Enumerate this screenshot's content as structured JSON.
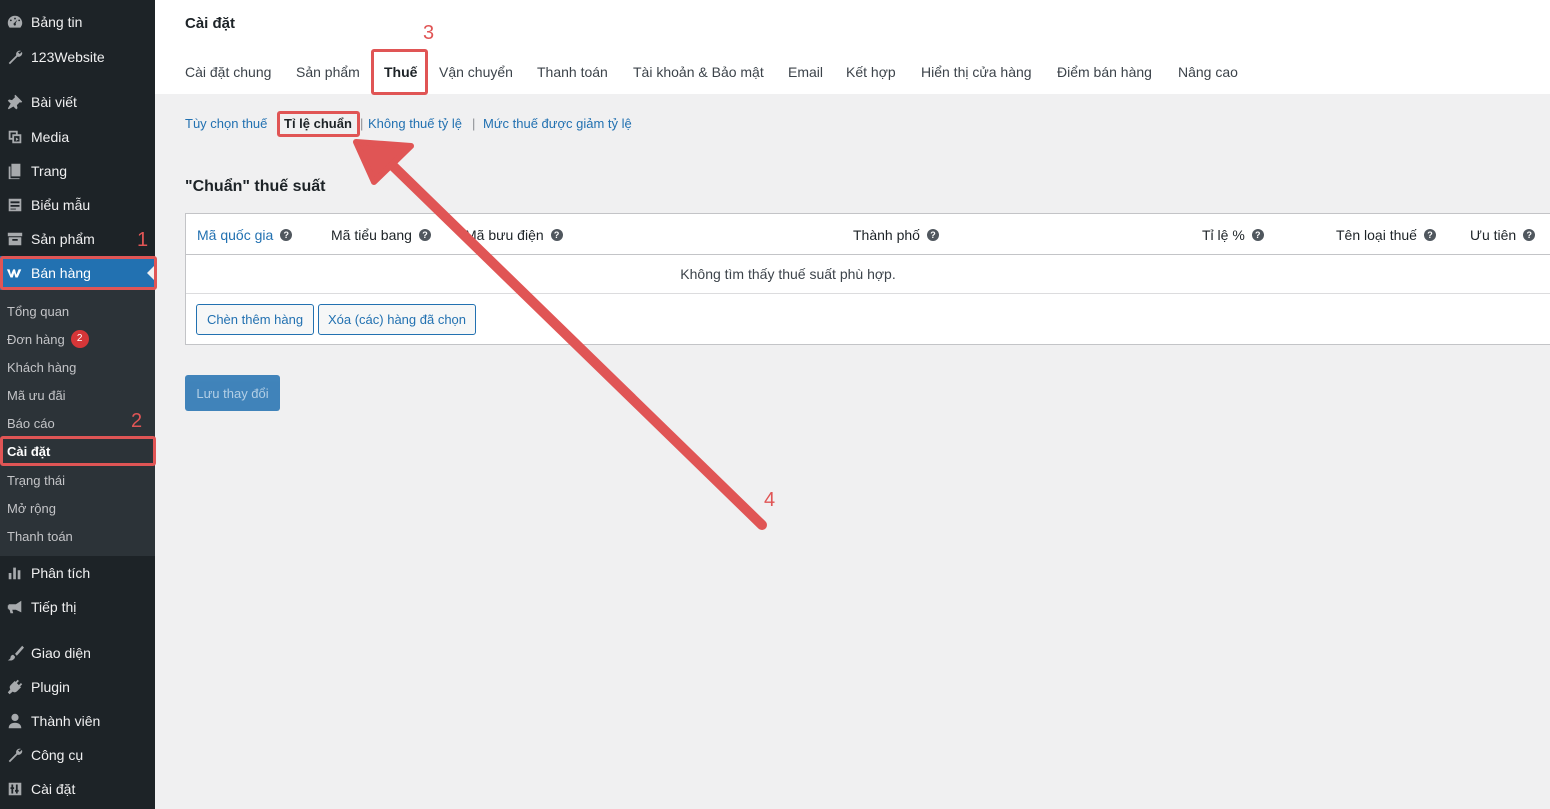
{
  "sidebar": {
    "items": [
      {
        "label": "Bảng tin",
        "icon": "dashboard-icon"
      },
      {
        "label": "123Website",
        "icon": "wrench-icon"
      },
      {
        "label": "Bài viết",
        "icon": "pin-icon"
      },
      {
        "label": "Media",
        "icon": "media-icon"
      },
      {
        "label": "Trang",
        "icon": "page-icon"
      },
      {
        "label": "Biểu mẫu",
        "icon": "form-icon"
      },
      {
        "label": "Sản phẩm",
        "icon": "archive-icon"
      },
      {
        "label": "Bán hàng",
        "icon": "woo-icon"
      },
      {
        "label": "Phân tích",
        "icon": "chart-icon"
      },
      {
        "label": "Tiếp thị",
        "icon": "megaphone-icon"
      },
      {
        "label": "Giao diện",
        "icon": "brush-icon"
      },
      {
        "label": "Plugin",
        "icon": "plug-icon"
      },
      {
        "label": "Thành viên",
        "icon": "user-icon"
      },
      {
        "label": "Công cụ",
        "icon": "tools-icon"
      },
      {
        "label": "Cài đặt",
        "icon": "settings-icon"
      }
    ],
    "submenu": [
      {
        "label": "Tổng quan"
      },
      {
        "label": "Đơn hàng",
        "badge": "2"
      },
      {
        "label": "Khách hàng"
      },
      {
        "label": "Mã ưu đãi"
      },
      {
        "label": "Báo cáo"
      },
      {
        "label": "Cài đặt"
      },
      {
        "label": "Trạng thái"
      },
      {
        "label": "Mở rộng"
      },
      {
        "label": "Thanh toán"
      }
    ]
  },
  "header": {
    "title": "Cài đặt",
    "tabs": [
      {
        "label": "Cài đặt chung"
      },
      {
        "label": "Sản phẩm"
      },
      {
        "label": "Thuế"
      },
      {
        "label": "Vận chuyển"
      },
      {
        "label": "Thanh toán"
      },
      {
        "label": "Tài khoản & Bảo mật"
      },
      {
        "label": "Email"
      },
      {
        "label": "Kết hợp"
      },
      {
        "label": "Hiển thị cửa hàng"
      },
      {
        "label": "Điểm bán hàng"
      },
      {
        "label": "Nâng cao"
      }
    ]
  },
  "tax_sections": [
    {
      "label": "Tùy chọn thuế"
    },
    {
      "label": "Tỉ lệ chuẩn"
    },
    {
      "label": "Không thuế tỷ lệ"
    },
    {
      "label": "Mức thuế được giảm tỷ lệ"
    }
  ],
  "separator": "|",
  "section_title": "\"Chuẩn\" thuế suất",
  "table": {
    "columns": [
      {
        "label": "Mã quốc gia"
      },
      {
        "label": "Mã tiểu bang"
      },
      {
        "label": "Mã bưu điện"
      },
      {
        "label": "Thành phố"
      },
      {
        "label": "Tỉ lệ %"
      },
      {
        "label": "Tên loại thuế"
      },
      {
        "label": "Ưu tiên"
      }
    ],
    "help_glyph": "?",
    "empty_message": "Không tìm thấy thuế suất phù hợp.",
    "insert_button": "Chèn thêm hàng",
    "delete_button": "Xóa (các) hàng đã chọn"
  },
  "save_button": "Lưu thay đổi",
  "annotations": {
    "step1": "1",
    "step2": "2",
    "step3": "3",
    "step4": "4",
    "color": "#e05555"
  },
  "colors": {
    "sidebar_bg": "#1d2327",
    "submenu_bg": "#2c3338",
    "accent": "#2271b1",
    "badge": "#d63638"
  }
}
